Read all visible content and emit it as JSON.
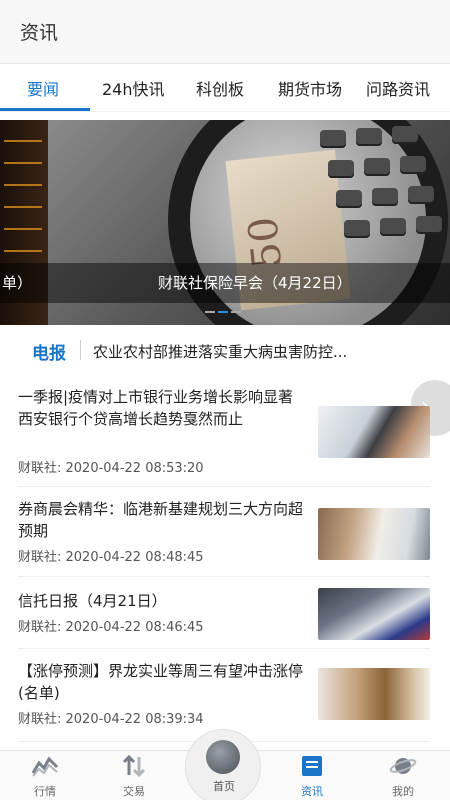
{
  "header": {
    "title": "资讯"
  },
  "tabs": [
    {
      "label": "要闻",
      "active": true
    },
    {
      "label": "24h快讯"
    },
    {
      "label": "科创板"
    },
    {
      "label": "期货市场"
    },
    {
      "label": "问路资讯"
    }
  ],
  "banner": {
    "caption": "财联社保险早会（4月22日）",
    "prev_caption_fragment": "单）",
    "bill_number": "50",
    "slide_indicator": {
      "count": 3,
      "active": 2
    }
  },
  "telegraph": {
    "label": "电报",
    "text": "农业农村部推进落实重大病虫害防控..."
  },
  "news": [
    {
      "title": "一季报|疫情对上市银行业务增长影响显著 西安银行个贷高增长趋势戛然而止",
      "meta": "财联社:   2020-04-22 08:53:20",
      "thumb": "phone-cards"
    },
    {
      "title": "券商晨会精华：临港新基建规划三大方向超预期",
      "meta": "财联社:   2020-04-22 08:48:45",
      "thumb": "business-desk"
    },
    {
      "title": "信托日报（4月21日）",
      "meta": "财联社:   2020-04-22 08:46:45",
      "thumb": "credit-cards"
    },
    {
      "title": "【涨停预测】界龙实业等周三有望冲击涨停(名单)",
      "meta": "财联社:   2020-04-22 08:39:34",
      "thumb": "coins"
    }
  ],
  "tabbar": [
    {
      "label": "行情",
      "icon": "market-chart-icon"
    },
    {
      "label": "交易",
      "icon": "trade-arrows-icon"
    },
    {
      "label": "首页",
      "icon": "globe-icon"
    },
    {
      "label": "资讯",
      "icon": "news-icon",
      "active": true
    },
    {
      "label": "我的",
      "icon": "planet-icon"
    }
  ],
  "colors": {
    "accent": "#1a75c9",
    "text": "#222222",
    "meta": "#555555"
  }
}
